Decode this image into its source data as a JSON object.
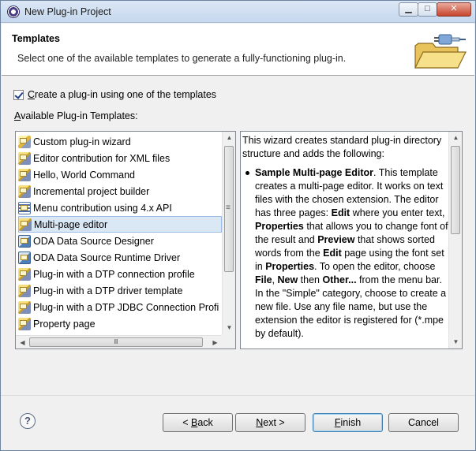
{
  "window": {
    "title": "New Plug-in Project",
    "minimize_glyph": "▁",
    "maximize_glyph": "□",
    "close_glyph": "✕"
  },
  "header": {
    "title": "Templates",
    "description": "Select one of the available templates to generate a fully-functioning plug-in."
  },
  "checkbox": {
    "checked": true,
    "label_mnemonic": "C",
    "label_rest": "reate a plug-in using one of the templates"
  },
  "available_label": {
    "mnemonic": "A",
    "rest": "vailable Plug-in Templates:"
  },
  "templates": {
    "items": [
      {
        "label": "Custom plug-in wizard",
        "icon": "wizard-icon"
      },
      {
        "label": "Editor contribution for XML files",
        "icon": "plugin-icon"
      },
      {
        "label": "Hello, World Command",
        "icon": "plugin-icon"
      },
      {
        "label": "Incremental project builder",
        "icon": "plugin-icon"
      },
      {
        "label": "Menu contribution using 4.x API",
        "icon": "menu-icon"
      },
      {
        "label": "Multi-page editor",
        "icon": "plugin-icon",
        "selected": true
      },
      {
        "label": "ODA Data Source Designer",
        "icon": "oda-icon"
      },
      {
        "label": "ODA Data Source Runtime Driver",
        "icon": "oda-icon"
      },
      {
        "label": "Plug-in with a DTP connection profile",
        "icon": "plugin-icon"
      },
      {
        "label": "Plug-in with a DTP driver template",
        "icon": "plugin-icon"
      },
      {
        "label": "Plug-in with a DTP JDBC Connection Profi",
        "icon": "plugin-icon"
      },
      {
        "label": "Property page",
        "icon": "plugin-icon"
      }
    ],
    "scroll_up_glyph": "▲",
    "scroll_down_glyph": "▼",
    "scroll_left_glyph": "◀",
    "scroll_right_glyph": "▶",
    "grip": "≡",
    "hgrip": "Ⅲ"
  },
  "description": {
    "intro": "This wizard creates standard plug-in directory structure and adds the following:",
    "bullet": [
      {
        "t": "Sample Multi-page Editor",
        "b": true
      },
      {
        "t": ". This template creates a multi-page editor. It works on text files with the chosen extension. The editor has three pages: "
      },
      {
        "t": "Edit",
        "b": true
      },
      {
        "t": " where you enter text, "
      },
      {
        "t": "Properties",
        "b": true
      },
      {
        "t": " that allows you to change font of the result and "
      },
      {
        "t": "Preview",
        "b": true
      },
      {
        "t": " that shows sorted words from the "
      },
      {
        "t": "Edit",
        "b": true
      },
      {
        "t": " page using the font set in "
      },
      {
        "t": "Properties",
        "b": true
      },
      {
        "t": ". To open the editor, choose "
      },
      {
        "t": "File",
        "b": true
      },
      {
        "t": ", "
      },
      {
        "t": "New",
        "b": true
      },
      {
        "t": " then "
      },
      {
        "t": "Other...",
        "b": true
      },
      {
        "t": " from the menu bar. In the \"Simple\" category, choose to create a new file. Use any file name, but use the extension the editor is registered for (*.mpe by default)."
      }
    ]
  },
  "footer": {
    "help_glyph": "?",
    "back": {
      "pre": "< ",
      "mnemonic": "B",
      "rest": "ack"
    },
    "next": {
      "mnemonic": "N",
      "rest": "ext >"
    },
    "finish": {
      "mnemonic": "F",
      "rest": "inish"
    },
    "cancel": "Cancel"
  }
}
